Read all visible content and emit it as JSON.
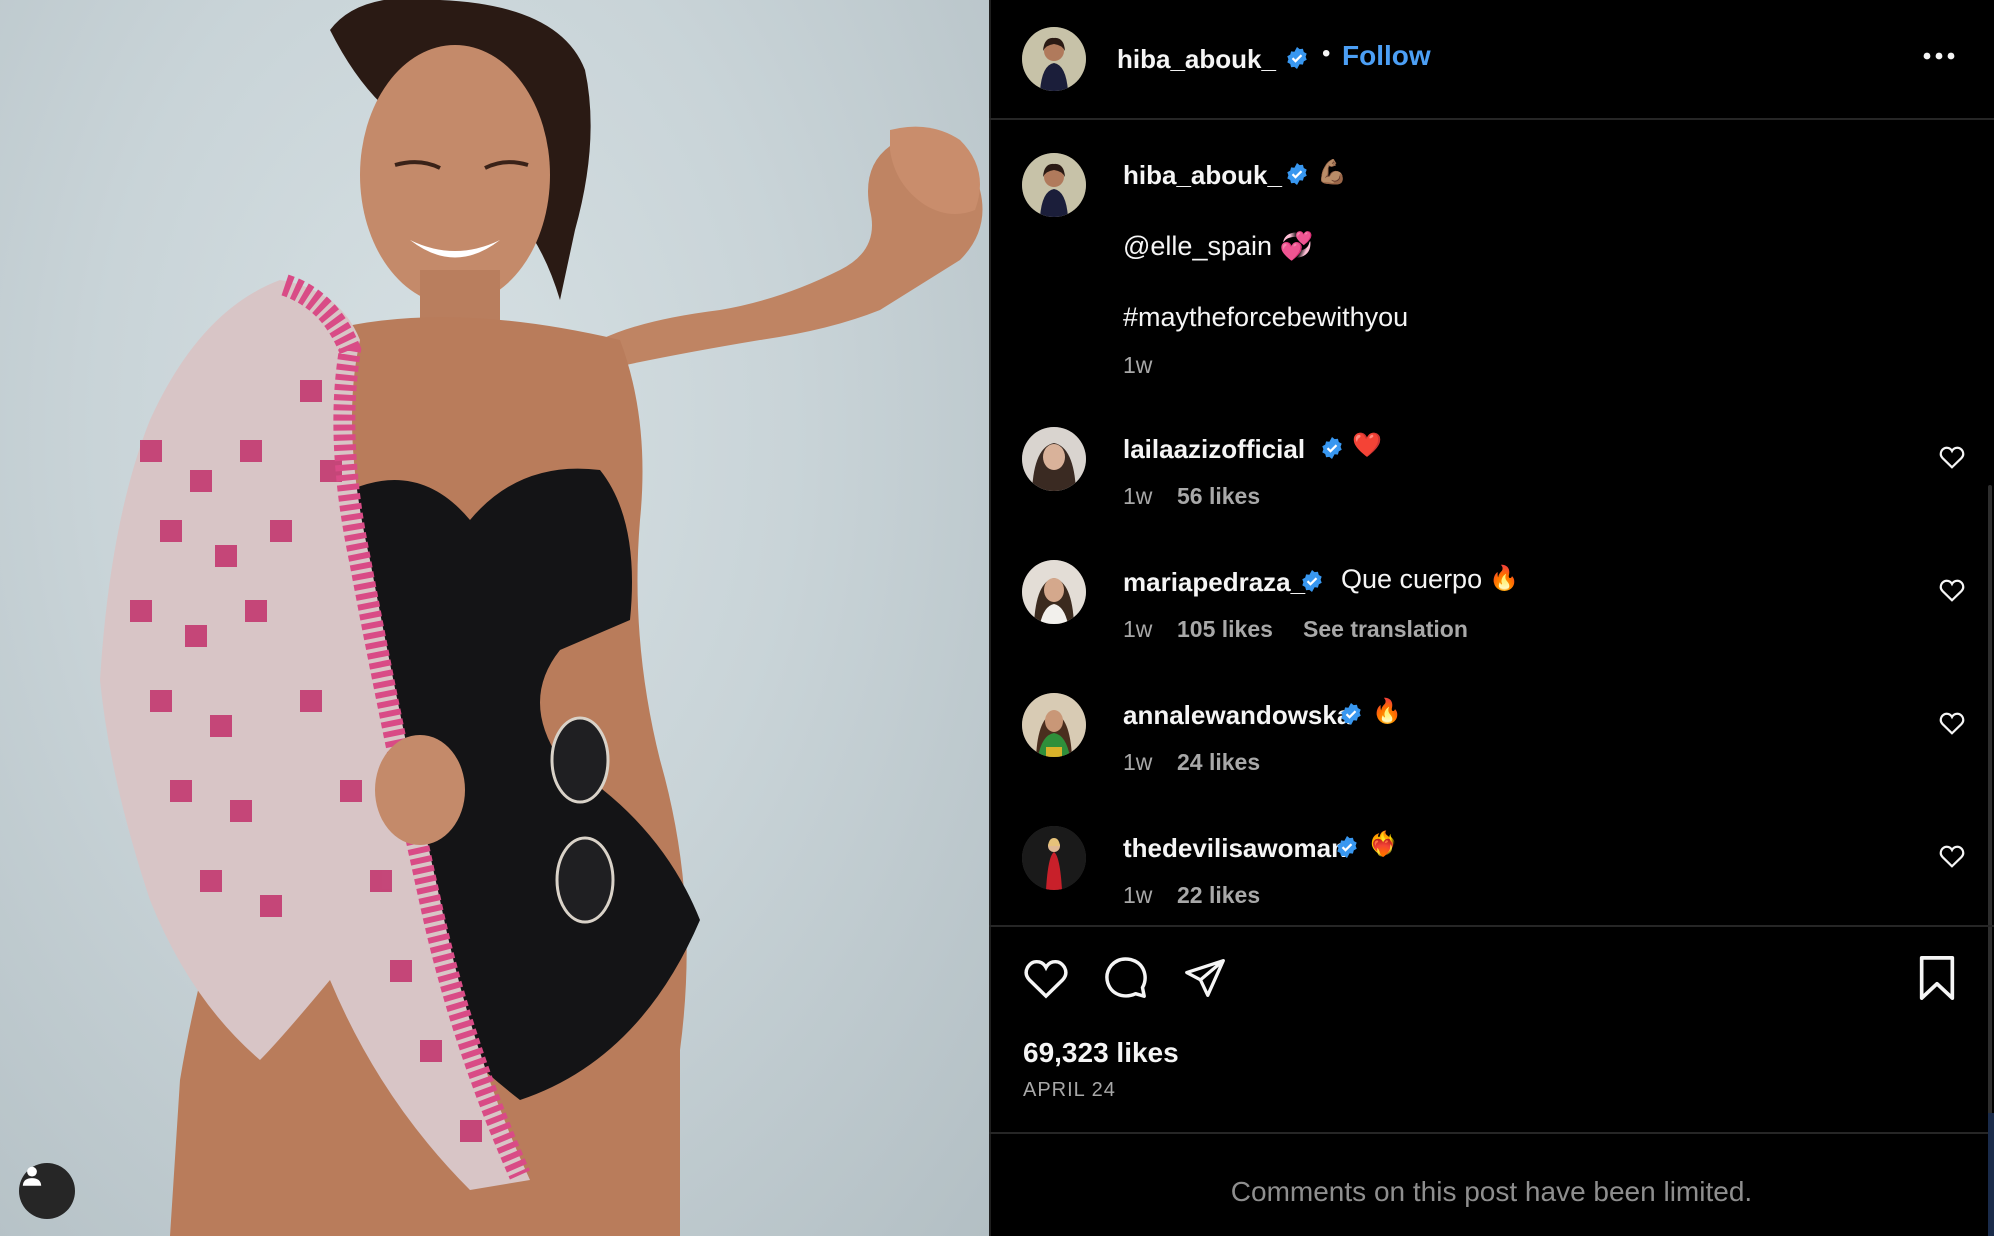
{
  "post": {
    "author": {
      "username": "hiba_abouk_",
      "verified": true,
      "avatar_icon": "profile-avatar"
    },
    "follow_label": "Follow",
    "separator": "•",
    "caption": {
      "username": "hiba_abouk_",
      "emoji": "💪🏽",
      "mention": "@elle_spain 💞",
      "hashtag": "#maytheforcebewithyou",
      "age": "1w"
    },
    "comments": [
      {
        "username": "lailaazizofficial",
        "text": "",
        "emoji": "❤️",
        "age": "1w",
        "likes": "56 likes",
        "translation": ""
      },
      {
        "username": "mariapedraza_",
        "text": "Que cuerpo",
        "emoji": "🔥",
        "age": "1w",
        "likes": "105 likes",
        "translation": "See translation"
      },
      {
        "username": "annalewandowska",
        "text": "",
        "emoji": "🔥",
        "age": "1w",
        "likes": "24 likes",
        "translation": ""
      },
      {
        "username": "thedevilisawoman",
        "text": "",
        "emoji": "❤️‍🔥",
        "age": "1w",
        "likes": "22 likes",
        "translation": ""
      }
    ],
    "likes_total": "69,323 likes",
    "date": "APRIL 24",
    "comments_limited": "Comments on this post have been limited.",
    "colors": {
      "background": "#000000",
      "accent_blue": "#4c9ff5",
      "verified_badge": "#3897f0",
      "muted_text": "#a8a8a8"
    },
    "icons": [
      "heart-icon",
      "comment-icon",
      "share-icon",
      "bookmark-icon",
      "more-icon",
      "verified-icon",
      "user-icon"
    ]
  }
}
